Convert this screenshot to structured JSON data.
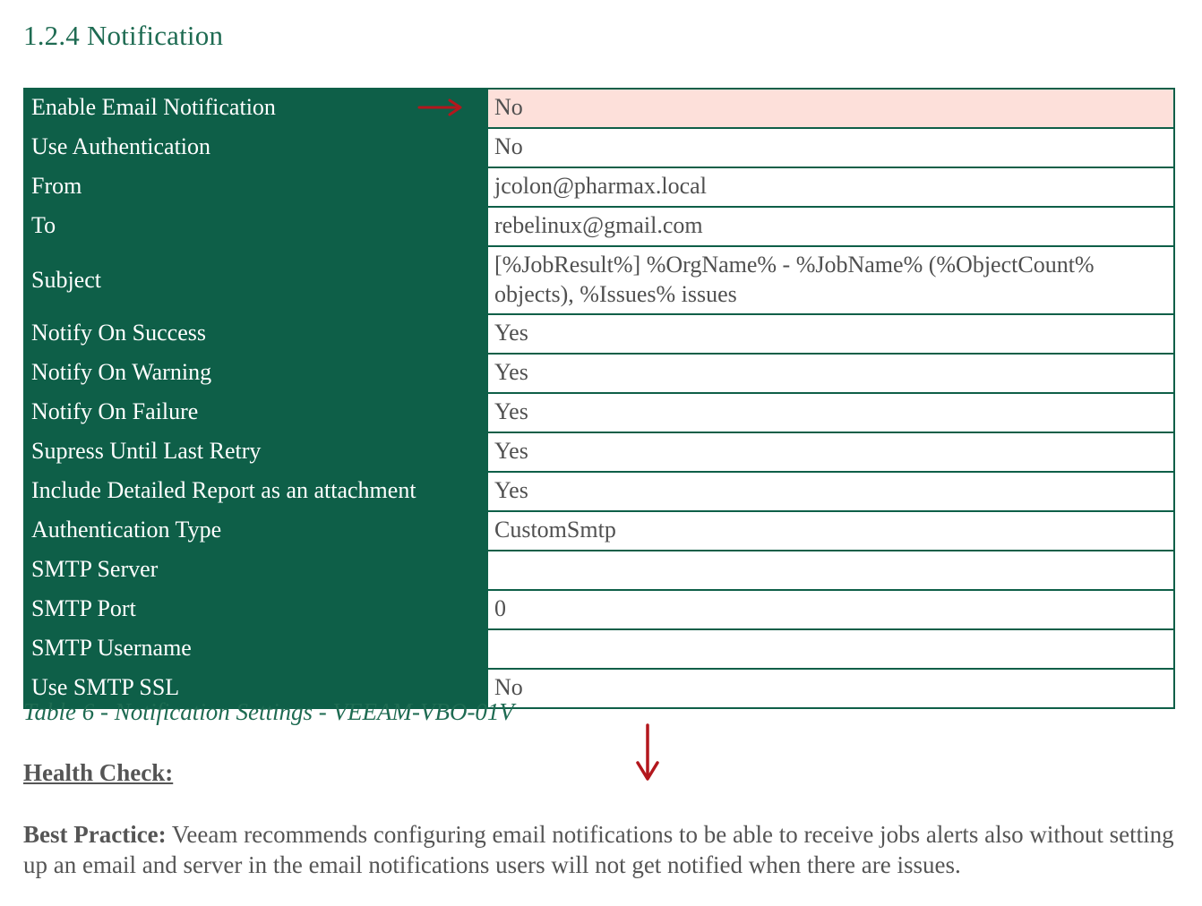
{
  "section_heading": "1.2.4 Notification",
  "table": {
    "rows": [
      {
        "label": "Enable Email Notification",
        "value": "No",
        "highlight": true
      },
      {
        "label": "Use Authentication",
        "value": "No"
      },
      {
        "label": "From",
        "value": "jcolon@pharmax.local"
      },
      {
        "label": "To",
        "value": "rebelinux@gmail.com"
      },
      {
        "label": "Subject",
        "value": "[%JobResult%] %OrgName% - %JobName% (%ObjectCount% objects), %Issues% issues"
      },
      {
        "label": "Notify On Success",
        "value": "Yes"
      },
      {
        "label": "Notify On Warning",
        "value": "Yes"
      },
      {
        "label": "Notify On Failure",
        "value": "Yes"
      },
      {
        "label": "Supress Until Last Retry",
        "value": "Yes"
      },
      {
        "label": "Include Detailed Report as an attachment",
        "value": "Yes"
      },
      {
        "label": "Authentication Type",
        "value": "CustomSmtp"
      },
      {
        "label": "SMTP Server",
        "value": ""
      },
      {
        "label": "SMTP Port",
        "value": "0"
      },
      {
        "label": "SMTP Username",
        "value": ""
      },
      {
        "label": "Use SMTP SSL",
        "value": "No"
      }
    ],
    "caption": "Table 6 - Notification Settings - VEEAM-VBO-01V"
  },
  "health_check": {
    "heading": "Health Check:",
    "best_practice_label": "Best Practice:",
    "best_practice_text": " Veeam recommends configuring email notifications to be able to receive jobs alerts also without setting up an email and server in the email notifications users will not get notified when there are issues."
  },
  "annotations": {
    "arrow_right_icon": "arrow-right-icon",
    "arrow_down_icon": "arrow-down-icon",
    "arrow_color": "#b3171d"
  },
  "colors": {
    "heading": "#1e6b52",
    "key_cell_bg": "#0e5f48",
    "highlight_bg": "#fde0da"
  }
}
